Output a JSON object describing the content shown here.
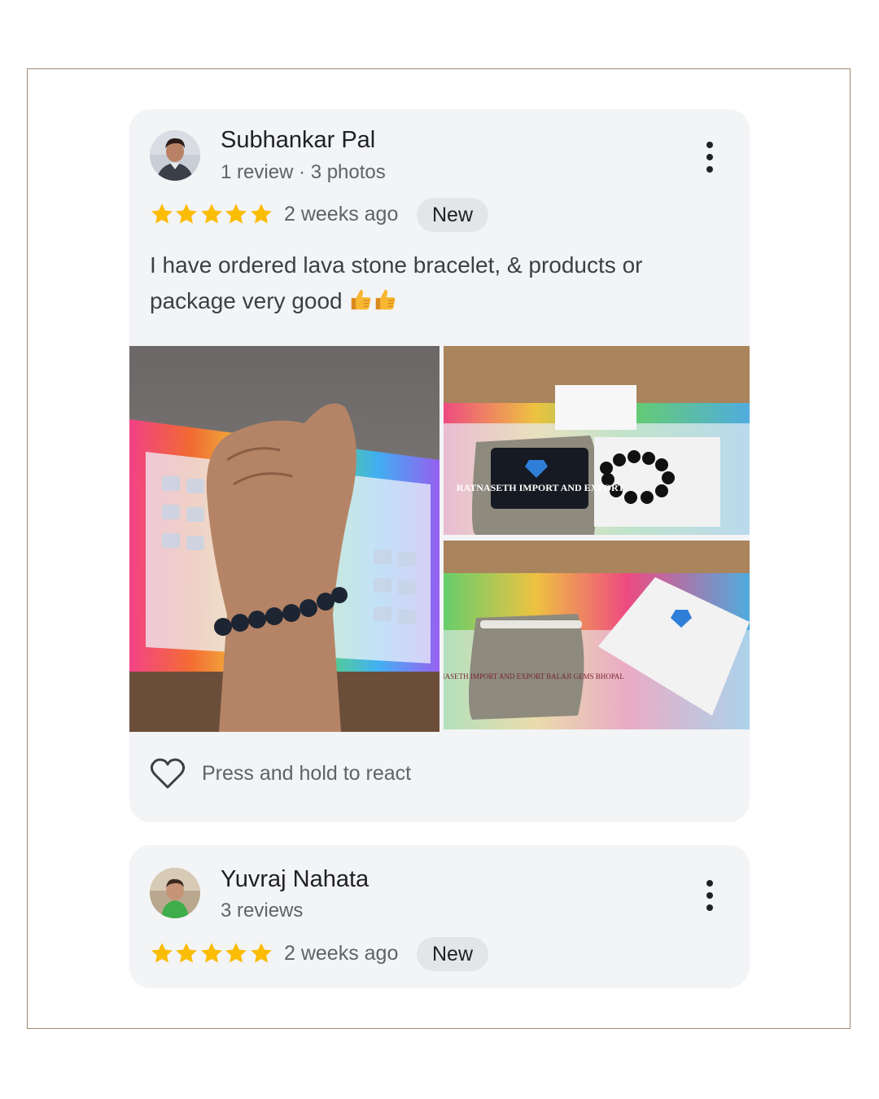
{
  "reviews": [
    {
      "name": "Subhankar Pal",
      "meta": "1 review · 3 photos",
      "rating": 5,
      "time": "2 weeks ago",
      "badge": "New",
      "text": "I have ordered lava stone bracelet, & products or package very good",
      "emoji": [
        "thumbs-up-emoji",
        "thumbs-up-emoji"
      ],
      "photos": [
        {
          "name": "photo-wrist-bracelet",
          "printed_text": ""
        },
        {
          "name": "photo-pouch-and-bracelet",
          "printed_text": "RATNASETH IMPORT AND EXPORT"
        },
        {
          "name": "photo-pouch-and-box",
          "printed_text": "RATNASETH IMPORT AND EXPORT BALAJI GEMS BHOPAL"
        }
      ],
      "react_label": "Press and hold to react"
    },
    {
      "name": "Yuvraj Nahata",
      "meta": "3 reviews",
      "rating": 5,
      "time": "2 weeks ago",
      "badge": "New"
    }
  ],
  "colors": {
    "star": "#fbbc04",
    "card_bg": "#f3f4f6",
    "badge_bg": "#e3e5e8",
    "frame_border": "#a08a6d"
  },
  "icons": [
    "more-vert-icon",
    "star-icon",
    "heart-outline-icon"
  ]
}
